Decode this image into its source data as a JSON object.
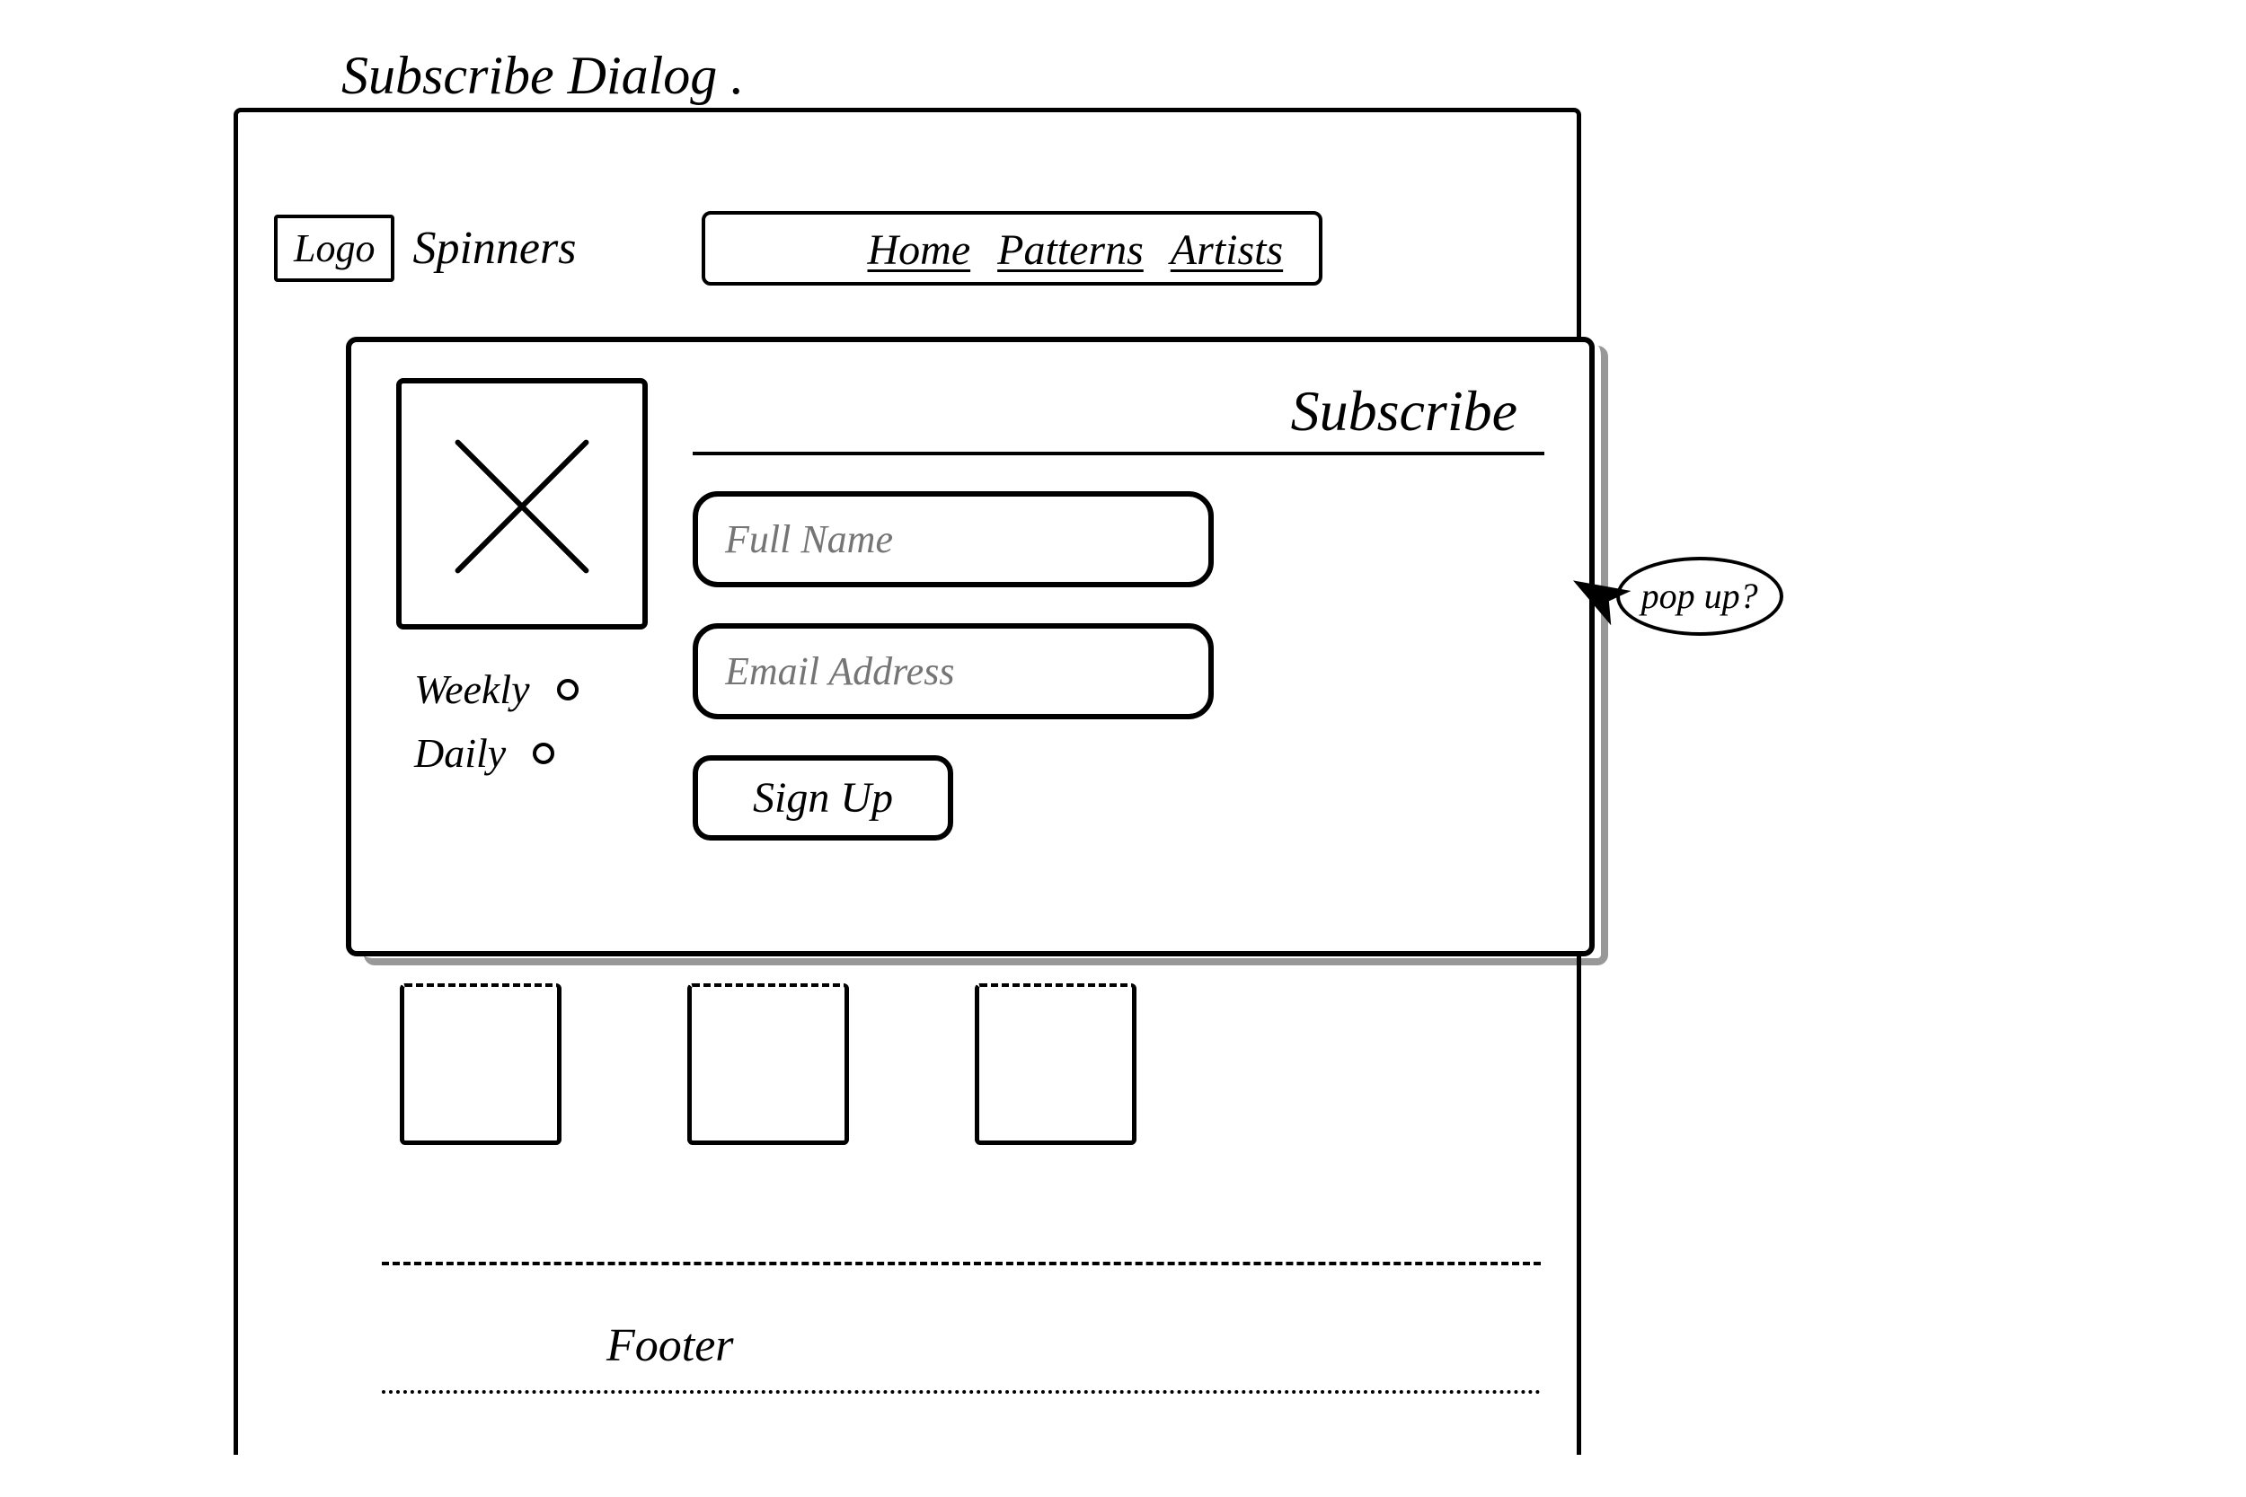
{
  "page_title": "Subscribe Dialog .",
  "header": {
    "logo_label": "Logo",
    "brand_name": "Spinners",
    "nav": [
      "Home",
      "Patterns",
      "Artists"
    ]
  },
  "dialog": {
    "title": "Subscribe",
    "close_icon": "x-icon",
    "fields": {
      "full_name_placeholder": "Full Name",
      "email_placeholder": "Email Address"
    },
    "frequency": [
      {
        "label": "Weekly"
      },
      {
        "label": "Daily"
      }
    ],
    "submit_label": "Sign Up"
  },
  "annotation": {
    "text": "pop up?"
  },
  "footer": {
    "label": "Footer"
  }
}
